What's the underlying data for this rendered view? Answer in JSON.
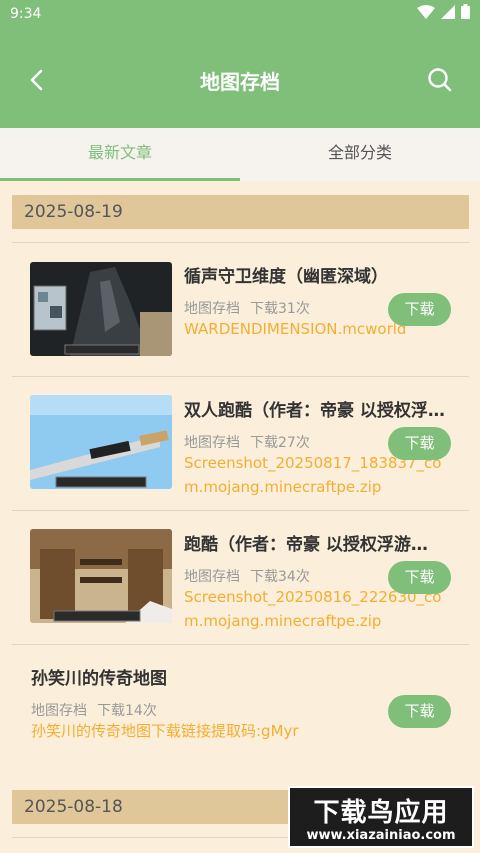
{
  "status_bar": {
    "time": "9:34",
    "icons": [
      "wifi-icon",
      "signal-icon",
      "battery-icon"
    ]
  },
  "header": {
    "title": "地图存档",
    "back_icon": "back-arrow-icon",
    "search_icon": "search-icon"
  },
  "tabs": [
    {
      "label": "最新文章",
      "active": true
    },
    {
      "label": "全部分类",
      "active": false
    }
  ],
  "sections": [
    {
      "date": "2025-08-19",
      "articles": [
        {
          "title": "循声守卫维度（幽匿深域）",
          "category": "地图存档",
          "downloads": "下载31次",
          "file": "WARDENDIMENSION.mcworld",
          "button": "下载"
        },
        {
          "title": "双人跑酷（作者：帝豪 以授权浮游…",
          "category": "地图存档",
          "downloads": "下载27次",
          "file": "Screenshot_20250817_183837_com.mojang.minecraftpe.zip",
          "button": "下载"
        },
        {
          "title": "跑酷（作者：帝豪 以授权浮游…",
          "category": "地图存档",
          "downloads": "下载34次",
          "file": "Screenshot_20250816_222630_com.mojang.minecraftpe.zip",
          "button": "下载"
        },
        {
          "title": "孙笑川的传奇地图",
          "category": "地图存档",
          "downloads": "下载14次",
          "file": "孙笑川的传奇地图下载链接提取码:gMyr",
          "button": "下载"
        }
      ]
    },
    {
      "date": "2025-08-18",
      "articles": []
    }
  ],
  "watermark": {
    "main": "下载鸟应用",
    "sub": "www.xiazainiao.com"
  },
  "colors": {
    "header": "#7fbf7a",
    "background": "#fbeeda",
    "date_band": "#dfc79a",
    "file_link": "#f3ae31"
  }
}
